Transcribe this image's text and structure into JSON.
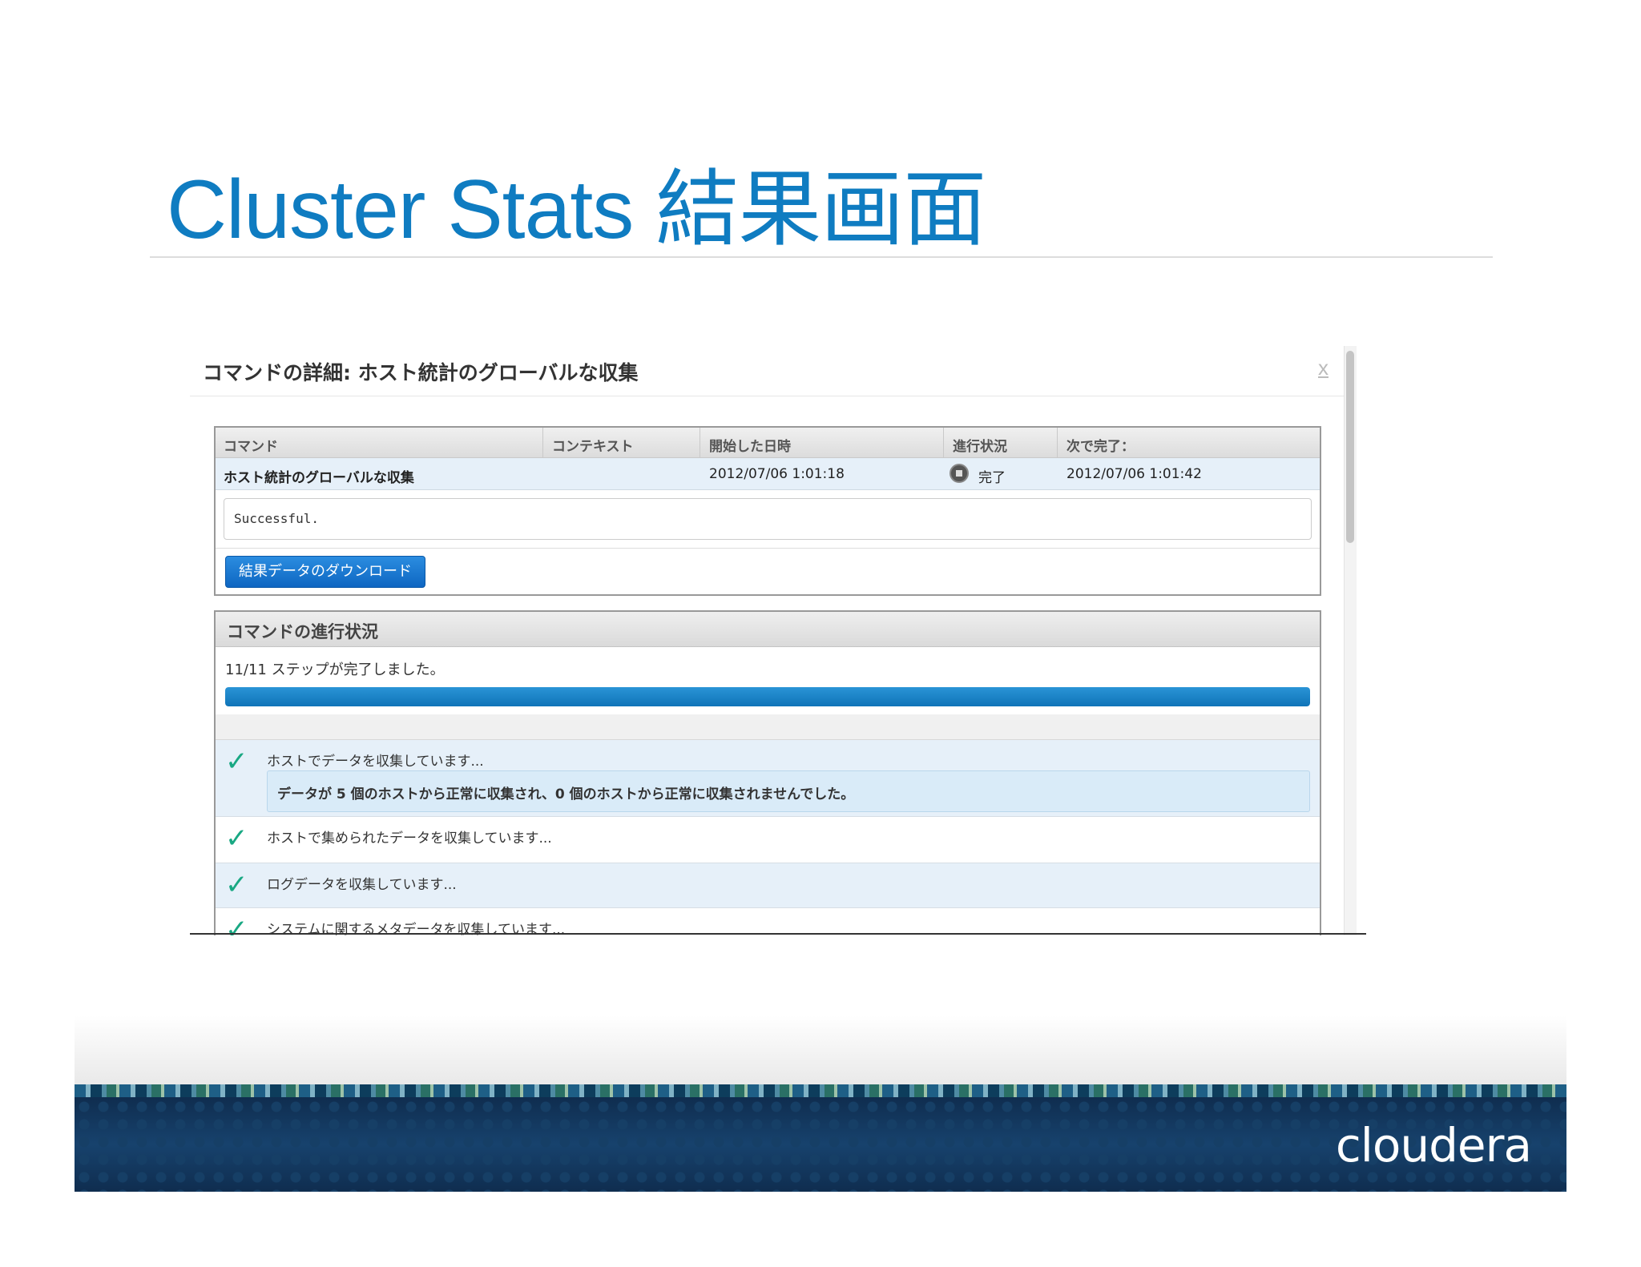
{
  "slide": {
    "title": "Cluster Stats 結果画面"
  },
  "dialog": {
    "title": "コマンドの詳細: ホスト統計のグローバルな収集",
    "close_label": "x"
  },
  "command_table": {
    "headers": [
      "コマンド",
      "コンテキスト",
      "開始した日時",
      "進行状況",
      "次で完了："
    ],
    "row": {
      "command": "ホスト統計のグローバルな収集",
      "context": "",
      "started": "2012/07/06 1:01:18",
      "status": "完了",
      "completed": "2012/07/06 1:01:42"
    },
    "result_text": "Successful.",
    "download_label": "結果データのダウンロード"
  },
  "progress": {
    "title": "コマンドの進行状況",
    "summary": "11/11 ステップが完了しました。",
    "fraction": 1.0,
    "accent_color": "#0f74b8",
    "steps": [
      {
        "label": "ホストでデータを収集しています...",
        "detail": "データが 5 個のホストから正常に収集され、0 個のホストから正常に収集されませんでした。"
      },
      {
        "label": "ホストで集められたデータを収集しています..."
      },
      {
        "label": "ログデータを収集しています..."
      },
      {
        "label": "システムに関するメタデータを収集しています..."
      }
    ],
    "check_icon": "check-icon"
  },
  "footer": {
    "logo_text": "cloudera"
  }
}
